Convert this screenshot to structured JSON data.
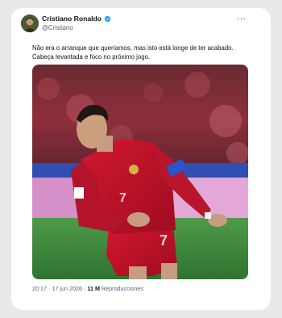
{
  "author": {
    "name": "Cristiano Ronaldo",
    "handle": "@Cristiano",
    "verified": true
  },
  "more_icon": "more-horizontal-icon",
  "tweet": {
    "text": "Não era o arranque que queríamos, mas isto está longe de ter acabado. Cabeça levantada e foco no próximo jogo."
  },
  "media": {
    "jersey_number": "7"
  },
  "meta": {
    "time": "20:17",
    "separator": "·",
    "date": "17 jun 2026",
    "dot": "·",
    "views_count": "11 M",
    "views_label": "Reproducciones"
  },
  "colors": {
    "verified_blue": "#1d9bf0",
    "jersey_red": "#c8102e",
    "pitch_green": "#3f8a3c"
  }
}
